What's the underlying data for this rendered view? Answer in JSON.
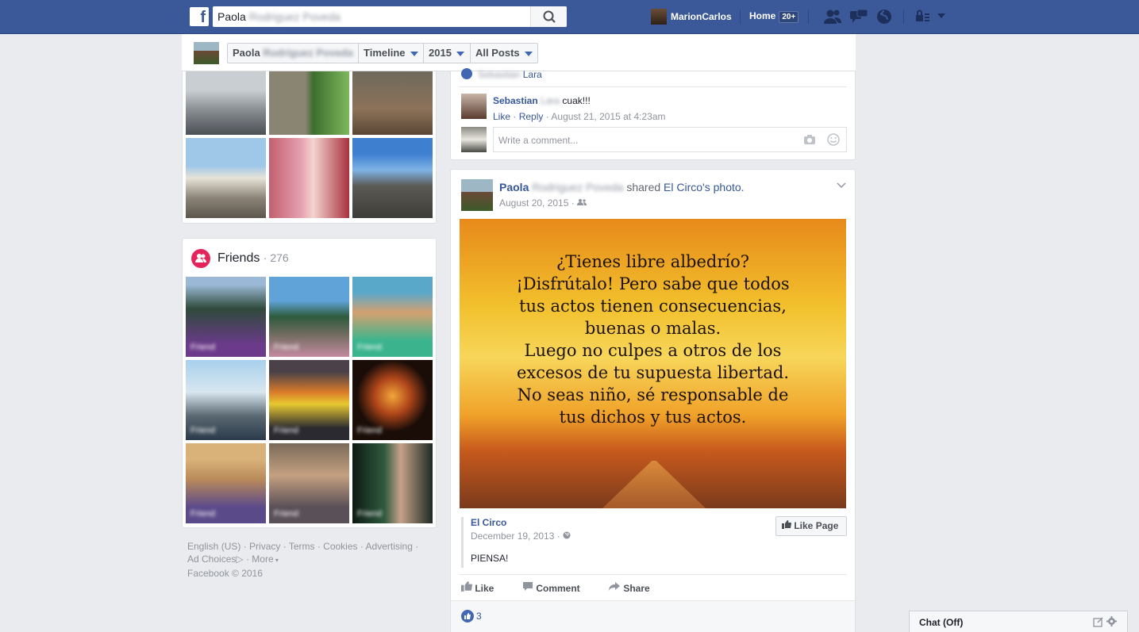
{
  "topbar": {
    "search_value": "Paola",
    "search_blurred": "Rodriguez Poveda",
    "user_name": "MarionCarlos",
    "home_label": "Home",
    "home_badge": "20+"
  },
  "subbar": {
    "name": "Paola",
    "name_blurred": "Rodriguez Poveda",
    "timeline_label": "Timeline",
    "year_label": "2015",
    "filter_label": "All Posts"
  },
  "friends": {
    "title": "Friends",
    "count": "· 276"
  },
  "footer": {
    "language": "English (US)",
    "privacy": "Privacy",
    "terms": "Terms",
    "cookies": "Cookies",
    "advertising": "Advertising",
    "ad_choices": "Ad Choices",
    "more": "More",
    "copyright": "Facebook © 2016"
  },
  "comment": {
    "prev_name_tail": "Lara",
    "author": "Sebastian",
    "author_blurred": "Lara",
    "text": "cuak!!!",
    "like": "Like",
    "reply": "Reply",
    "date": "August 21, 2015 at 4:23am",
    "input_placeholder": "Write a comment..."
  },
  "post": {
    "author": "Paola",
    "author_blurred": "Rodriguez Poveda",
    "shared_text": "shared",
    "page_name": "El Circo",
    "possessive": "'s",
    "photo_word": "photo",
    "period": ".",
    "date": "August 20, 2015",
    "image_text_lines": [
      "¿Tienes libre albedrío?",
      "¡Disfrútalo! Pero sabe que todos",
      "tus actos tienen consecuencias,",
      "buenas o malas.",
      "Luego no culpes a otros de los",
      "excesos de tu supuesta libertad.",
      "No seas niño, sé responsable de",
      "tus dichos y tus actos."
    ],
    "origin_page": "El Circo",
    "origin_date": "December 19, 2013",
    "like_page_label": "Like Page",
    "origin_text": "PIENSA!",
    "like_label": "Like",
    "comment_label": "Comment",
    "share_label": "Share",
    "like_count": "3"
  },
  "chat": {
    "label": "Chat (Off)"
  },
  "colors": {
    "brand": "#3b5998",
    "link": "#365899",
    "friends_icon": "#e4245a"
  }
}
